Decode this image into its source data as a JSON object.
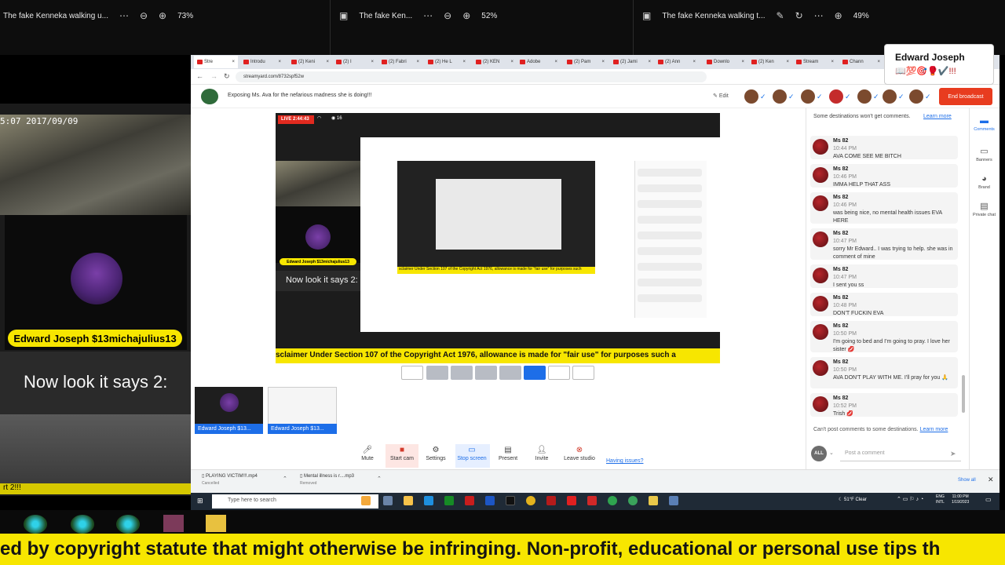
{
  "viewer_strip": {
    "title_left": "The fake Kenneka walking u...",
    "zoom_left": "73%",
    "title_mid": "The fake Ken...",
    "zoom_mid": "52%",
    "title_right": "The fake Kenneka walking t...",
    "zoom_right": "49%",
    "more_icon": "more-icon",
    "zoom_out_icon": "zoom-out-icon",
    "zoom_in_icon": "zoom-in-icon"
  },
  "left_panel": {
    "timestamp": "5:07  2017/09/09",
    "guest_name": "Edward Joseph $13michajulius13",
    "caption": "Now look it says 2:",
    "ticker": "rt 2!!!"
  },
  "browser": {
    "tabs": [
      "Stre",
      "Introdu",
      "(2) Keni",
      "(2) I",
      "(2) Fabri",
      "(2) He L",
      "(2) KEN",
      "Adobe",
      "(2) Pam",
      "(2) Jami",
      "(2) Ann",
      "Downlo",
      "(2) Ken",
      "Stream",
      "Chann"
    ],
    "url": "streamyard.com/8732spf52w",
    "studio_title": "Exposing Ms. Ava for the nefarious madness she is doing!!!",
    "edit_label": "Edit",
    "end_broadcast": "End broadcast"
  },
  "name_overlay": {
    "name": "Edward Joseph",
    "emoji": "📖💯🎯🥊✔️!!!"
  },
  "stage": {
    "live_badge": "LIVE 2:44:43",
    "viewer_count": "16",
    "inner_guest_name": "Edward Joseph $13michajulius13",
    "inner_caption": "Now look it says 2:",
    "ticker": "sclaimer Under Section 107 of the Copyright Act 1976, allowance is made for \"fair use\" for purposes such a",
    "inner_ticker": "sclaimer Under Section 107 of the Copyright Act 1976, allowance is made for \"fair use\" for purposes such",
    "thumb1_label": "Edward Joseph $13...",
    "thumb2_label": "Edward Joseph $13..."
  },
  "controls": {
    "mute": "Mute",
    "start_cam": "Start cam",
    "settings": "Settings",
    "stop_screen": "Stop screen",
    "present": "Present",
    "invite": "Invite",
    "leave_studio": "Leave studio",
    "having_issues": "Having issues?"
  },
  "chat": {
    "notice": "Some destinations won't get comments.",
    "notice_link": "Learn more",
    "messages": [
      {
        "user": "Ms 82",
        "time": "10:44 PM",
        "text": "AVA COME SEE ME BITCH"
      },
      {
        "user": "Ms 82",
        "time": "10:46 PM",
        "text": "IMMA HELP THAT ASS"
      },
      {
        "user": "Ms 82",
        "time": "10:46 PM",
        "text": "was being nice, no mental health issues EVA HERE"
      },
      {
        "user": "Ms 82",
        "time": "10:47 PM",
        "text": "sorry Mr Edward.. I was trying to help. she was in comment of mine"
      },
      {
        "user": "Ms 82",
        "time": "10:47 PM",
        "text": "I sent you ss"
      },
      {
        "user": "Ms 82",
        "time": "10:48 PM",
        "text": "DON'T FUCKIN EVA"
      },
      {
        "user": "Ms 82",
        "time": "10:50 PM",
        "text": "I'm going to bed and I'm going to pray. I love her sister 💋"
      },
      {
        "user": "Ms 82",
        "time": "10:50 PM",
        "text": "AVA DON'T PLAY WITH ME. I'll pray for you 🙏"
      },
      {
        "user": "Ms 82",
        "time": "10:52 PM",
        "text": "Trish 💋"
      }
    ],
    "cant_post": "Can't post comments to some destinations.",
    "cant_post_link": "Learn more",
    "all_badge": "ALL",
    "input_placeholder": "Post a comment"
  },
  "sidebar": {
    "items": [
      "Comments",
      "Banners",
      "Brand",
      "Private chat"
    ]
  },
  "downloads": {
    "items": [
      {
        "name": "PLAYING VICTIM!!!.mp4",
        "status": "Cancelled"
      },
      {
        "name": "Mental illness is r....mp3",
        "status": "Removed"
      }
    ],
    "show_all": "Show all"
  },
  "taskbar": {
    "search_placeholder": "Type here to search",
    "weather": "51°F  Clear",
    "lang_top": "ENG",
    "lang_bottom": "INTL",
    "time": "11:00 PM",
    "date": "1/19/2023"
  },
  "bottom_ticker": "ed by copyright statute that might otherwise be infringing. Non-profit, educational or personal use tips th",
  "colors": {
    "ticker_yellow": "#f7e600",
    "end_broadcast_red": "#e83c1f",
    "accent_blue": "#1d6ee8"
  }
}
